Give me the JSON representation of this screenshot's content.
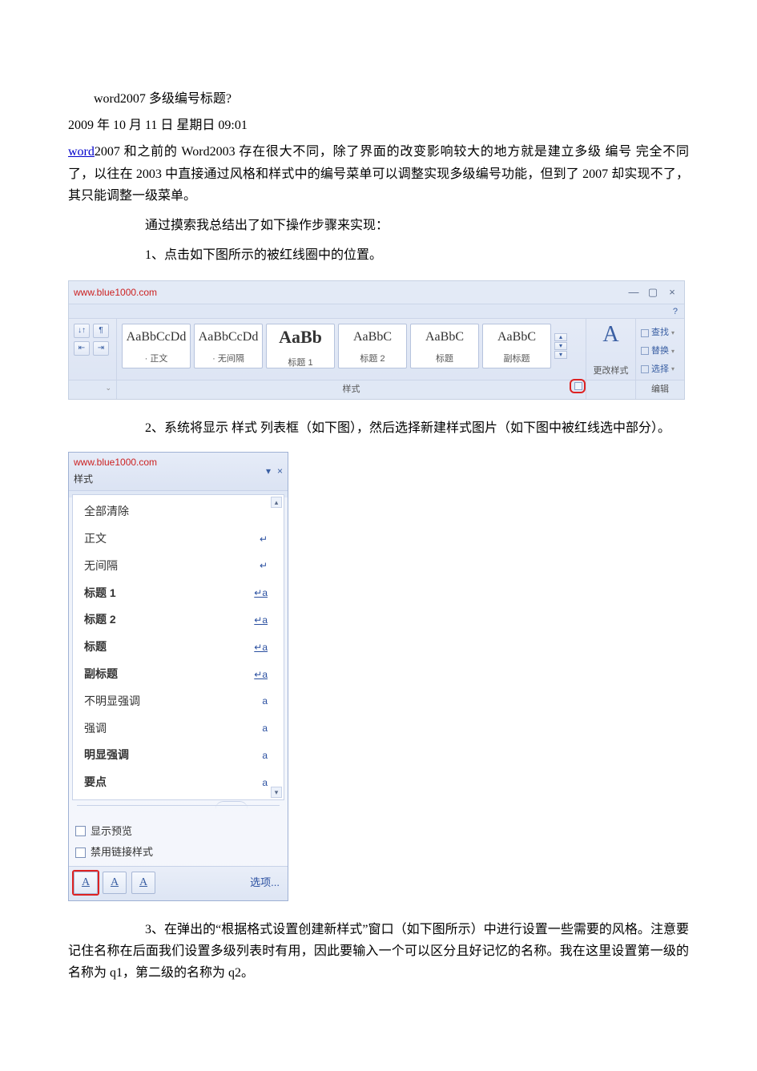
{
  "article": {
    "title": "word2007 多级编号标题?",
    "datetime": "2009 年 10 月 11 日 星期日 09:01",
    "word_link_text": "word",
    "intro_after_link": "2007 和之前的 Word2003 存在很大不同，除了界面的改变影响较大的地方就是建立多级 编号 完全不同了，以往在 2003 中直接通过风格和样式中的编号菜单可以调整实现多级编号功能，但到了 2007 却实现不了，其只能调整一级菜单。",
    "p1": "通过摸索我总结出了如下操作步骤来实现：",
    "step1": "1、点击如下图所示的被红线圈中的位置。",
    "step2": "2、系统将显示 样式 列表框（如下图），然后选择新建样式图片（如下图中被红线选中部分）。",
    "step3": "3、在弹出的“根据格式设置创建新样式”窗口（如下图所示）中进行设置一些需要的风格。注意要记住名称在后面我们设置多级列表时有用，因此要输入一个可以区分且好记忆的名称。我在这里设置第一级的名称为 q1，第二级的名称为 q2。"
  },
  "ribbon": {
    "watermark": "www.blue1000.com",
    "win_buttons": {
      "min": "—",
      "max": "▢",
      "close": "×"
    },
    "help_icon": "?",
    "left_group_label_launcher": "⌄",
    "style_tiles": [
      {
        "preview": "AaBbCcDd",
        "label": "· 正文",
        "big": false
      },
      {
        "preview": "AaBbCcDd",
        "label": "· 无间隔",
        "big": false
      },
      {
        "preview": "AaBb",
        "label": "标题 1",
        "big": true
      },
      {
        "preview": "AaBbC",
        "label": "标题 2",
        "big": false
      },
      {
        "preview": "AaBbC",
        "label": "标题",
        "big": false
      },
      {
        "preview": "AaBbC",
        "label": "副标题",
        "big": false
      }
    ],
    "change_style": {
      "glyph": "A",
      "label": "更改样式"
    },
    "edit_group": {
      "items": [
        {
          "label": "查找"
        },
        {
          "label": "替换"
        },
        {
          "label": "选择"
        }
      ],
      "footer": "编辑"
    },
    "footer_styles_label": "样式"
  },
  "styles_pane": {
    "watermark": "www.blue1000.com",
    "subtitle": "样式",
    "close": "×",
    "dropdown": "▾",
    "scroll_up": "▴",
    "scroll_down": "▾",
    "items": [
      {
        "name": "全部清除",
        "mark": "",
        "bold": false,
        "markClass": ""
      },
      {
        "name": "正文",
        "mark": "↵",
        "bold": false,
        "markClass": ""
      },
      {
        "name": "无间隔",
        "mark": "↵",
        "bold": false,
        "markClass": ""
      },
      {
        "name": "标题 1",
        "mark": "↵a",
        "bold": true,
        "markClass": "ul"
      },
      {
        "name": "标题 2",
        "mark": "↵a",
        "bold": true,
        "markClass": "ul"
      },
      {
        "name": "标题",
        "mark": "↵a",
        "bold": true,
        "markClass": "ul"
      },
      {
        "name": "副标题",
        "mark": "↵a",
        "bold": true,
        "markClass": "ul"
      },
      {
        "name": "不明显强调",
        "mark": "a",
        "bold": false,
        "markClass": ""
      },
      {
        "name": "强调",
        "mark": "a",
        "bold": false,
        "markClass": ""
      },
      {
        "name": "明显强调",
        "mark": "a",
        "bold": true,
        "markClass": ""
      },
      {
        "name": "要点",
        "mark": "a",
        "bold": true,
        "markClass": ""
      }
    ],
    "check1": "显示预览",
    "check2": "禁用链接样式",
    "btn_labels": [
      "A",
      "A",
      "A"
    ],
    "options_link": "选项..."
  }
}
